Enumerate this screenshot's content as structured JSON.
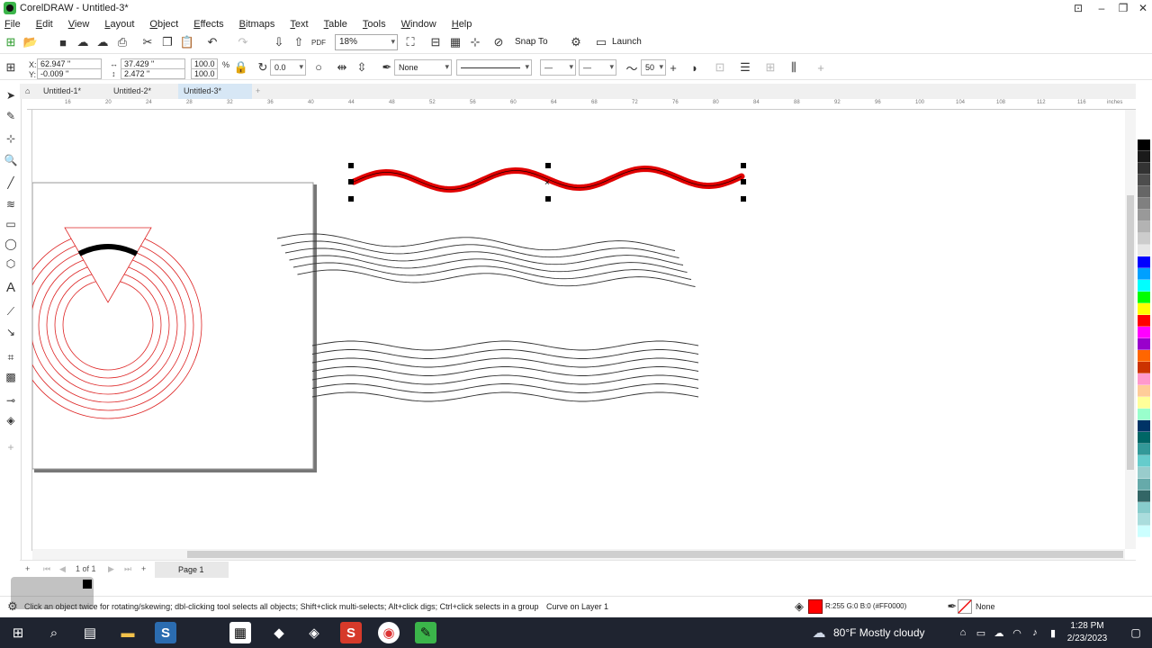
{
  "window": {
    "title": "CorelDRAW - Untitled-3*"
  },
  "menu": [
    "File",
    "Edit",
    "View",
    "Layout",
    "Object",
    "Effects",
    "Bitmaps",
    "Text",
    "Table",
    "Tools",
    "Window",
    "Help"
  ],
  "toolbar": {
    "zoom": "18%",
    "snap_label": "Snap To",
    "launch_label": "Launch"
  },
  "propbar": {
    "x_label": "X:",
    "x": "62.947 \"",
    "y_label": "Y:",
    "y": "-0.009 \"",
    "w": "37.429 \"",
    "h": "2.472 \"",
    "scale_x": "100.0",
    "scale_y": "100.0",
    "pct": "%",
    "rotation": "0.0",
    "outline_width": "None",
    "smoothing": "50"
  },
  "tabs": [
    "Untitled-1*",
    "Untitled-2*",
    "Untitled-3*"
  ],
  "ruler": {
    "units": "inches",
    "ticks": [
      "16",
      "20",
      "24",
      "28",
      "32",
      "36",
      "40",
      "44",
      "48",
      "52",
      "56",
      "60",
      "64",
      "68",
      "72",
      "76",
      "80",
      "84",
      "88",
      "92",
      "96",
      "100",
      "104",
      "108",
      "112",
      "116"
    ]
  },
  "pagenav": {
    "page_of": "1 of 1",
    "page_tab": "Page 1"
  },
  "status": {
    "hint": "Click an object twice for rotating/skewing; dbl-clicking tool selects all objects; Shift+click multi-selects; Alt+click digs; Ctrl+click selects in a group",
    "object": "Curve on Layer 1",
    "fill": "R:255 G:0 B:0 (#FF0000)",
    "outline": "None"
  },
  "palette": [
    "#ffffff",
    "#000000",
    "#1a1a1a",
    "#333333",
    "#4d4d4d",
    "#666666",
    "#808080",
    "#999999",
    "#b3b3b3",
    "#cccccc",
    "#e6e6e6",
    "#0000ff",
    "#00a0ff",
    "#00ffff",
    "#00ff00",
    "#ffff00",
    "#ff0000",
    "#ff00ff",
    "#9900cc",
    "#ff6600",
    "#cc3300",
    "#ff99cc",
    "#ffcc99",
    "#ffff99",
    "#99ffcc",
    "#003366",
    "#006666",
    "#339999",
    "#66cccc",
    "#99cccc",
    "#66aaaa",
    "#336666",
    "#88cccc",
    "#aadddd",
    "#ccffff",
    "#ffffff"
  ],
  "taskbar": {
    "weather": "80°F  Mostly cloudy",
    "time": "1:28 PM",
    "date": "2/23/2023"
  }
}
